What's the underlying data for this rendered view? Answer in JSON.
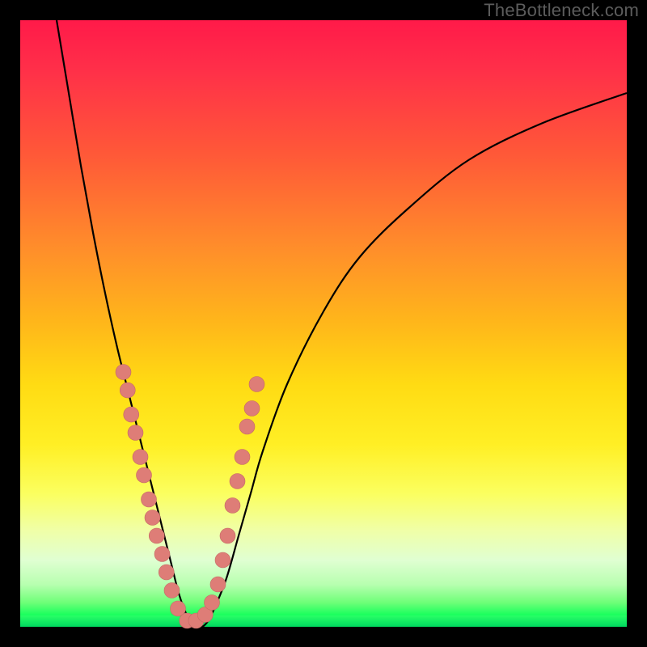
{
  "watermark": "TheBottleneck.com",
  "colors": {
    "page_bg": "#000000",
    "gradient_top": "#ff1a49",
    "gradient_bottom": "#00e866",
    "curve": "#000000",
    "marker_fill": "#de7d77"
  },
  "chart_data": {
    "type": "line",
    "title": "",
    "xlabel": "",
    "ylabel": "",
    "xlim": [
      0,
      100
    ],
    "ylim": [
      0,
      100
    ],
    "grid": false,
    "legend": false,
    "series": [
      {
        "name": "bottleneck-curve",
        "x": [
          6,
          8,
          10,
          12,
          14,
          16,
          18,
          20,
          22,
          23,
          24,
          25,
          26,
          27,
          28,
          29,
          30,
          31,
          32,
          34,
          36,
          38,
          40,
          44,
          50,
          56,
          64,
          74,
          86,
          100
        ],
        "y": [
          100,
          88,
          76,
          65,
          55,
          46,
          38,
          30,
          22,
          18,
          14,
          10,
          6,
          3,
          1,
          0,
          0,
          1,
          3,
          8,
          15,
          22,
          29,
          40,
          52,
          61,
          69,
          77,
          83,
          88
        ]
      }
    ],
    "markers": {
      "name": "highlight-points",
      "points_xy": [
        [
          17.0,
          42
        ],
        [
          17.7,
          39
        ],
        [
          18.3,
          35
        ],
        [
          19.0,
          32
        ],
        [
          19.8,
          28
        ],
        [
          20.4,
          25
        ],
        [
          21.2,
          21
        ],
        [
          21.8,
          18
        ],
        [
          22.5,
          15
        ],
        [
          23.4,
          12
        ],
        [
          24.1,
          9
        ],
        [
          25.0,
          6
        ],
        [
          26.0,
          3
        ],
        [
          27.5,
          1
        ],
        [
          29.0,
          1
        ],
        [
          30.5,
          2
        ],
        [
          31.6,
          4
        ],
        [
          32.6,
          7
        ],
        [
          33.4,
          11
        ],
        [
          34.2,
          15
        ],
        [
          35.0,
          20
        ],
        [
          35.8,
          24
        ],
        [
          36.6,
          28
        ],
        [
          37.4,
          33
        ],
        [
          38.2,
          36
        ],
        [
          39.0,
          40
        ]
      ]
    }
  }
}
